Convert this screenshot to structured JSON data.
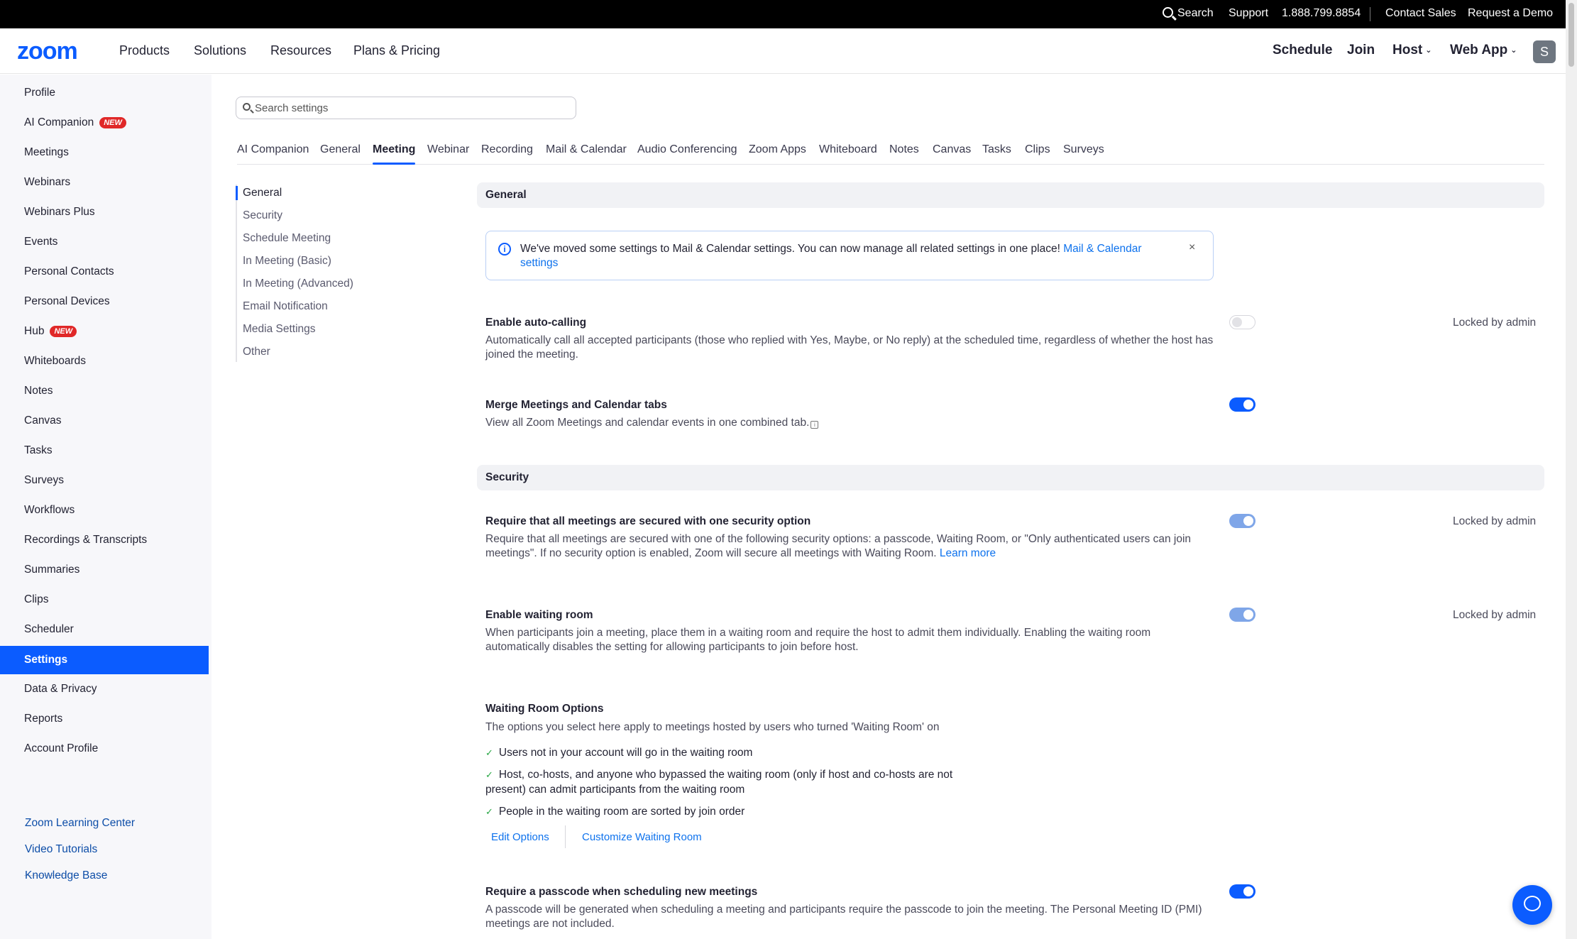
{
  "topbar": {
    "search": "Search",
    "support": "Support",
    "phone": "1.888.799.8854",
    "contact_sales": "Contact Sales",
    "request_demo": "Request a Demo"
  },
  "nav": {
    "logo": "zoom",
    "items": [
      "Products",
      "Solutions",
      "Resources",
      "Plans & Pricing"
    ],
    "schedule": "Schedule",
    "join": "Join",
    "host": "Host",
    "web_app": "Web App",
    "avatar_initial": "S"
  },
  "sidebar": {
    "items": [
      {
        "label": "Profile"
      },
      {
        "label": "AI Companion",
        "badge": "NEW"
      },
      {
        "label": "Meetings"
      },
      {
        "label": "Webinars"
      },
      {
        "label": "Webinars Plus"
      },
      {
        "label": "Events"
      },
      {
        "label": "Personal Contacts"
      },
      {
        "label": "Personal Devices"
      },
      {
        "label": "Hub",
        "badge": "NEW"
      },
      {
        "label": "Whiteboards"
      },
      {
        "label": "Notes"
      },
      {
        "label": "Canvas"
      },
      {
        "label": "Tasks"
      },
      {
        "label": "Surveys"
      },
      {
        "label": "Workflows"
      },
      {
        "label": "Recordings & Transcripts"
      },
      {
        "label": "Summaries"
      },
      {
        "label": "Clips"
      },
      {
        "label": "Scheduler"
      },
      {
        "label": "Settings"
      },
      {
        "label": "Data & Privacy"
      },
      {
        "label": "Reports"
      },
      {
        "label": "Account Profile"
      }
    ],
    "links": [
      "Zoom Learning Center",
      "Video Tutorials",
      "Knowledge Base"
    ]
  },
  "search": {
    "placeholder": "Search settings"
  },
  "tabs": [
    "AI Companion",
    "General",
    "Meeting",
    "Webinar",
    "Recording",
    "Mail & Calendar",
    "Audio Conferencing",
    "Zoom Apps",
    "Whiteboard",
    "Notes",
    "Canvas",
    "Tasks",
    "Clips",
    "Surveys"
  ],
  "subnav": [
    "General",
    "Security",
    "Schedule Meeting",
    "In Meeting (Basic)",
    "In Meeting (Advanced)",
    "Email Notification",
    "Media Settings",
    "Other"
  ],
  "sections": {
    "general": "General",
    "security": "Security"
  },
  "notice": {
    "text": "We've moved some settings to Mail & Calendar settings. You can now manage all related settings in one place! ",
    "link": "Mail & Calendar settings",
    "close": "×"
  },
  "settings": {
    "auto_calling": {
      "title": "Enable auto-calling",
      "desc": "Automatically call all accepted participants (those who replied with Yes, Maybe, or No reply) at the scheduled time, regardless of whether the host has joined the meeting.",
      "locked": "Locked by admin"
    },
    "merge_tabs": {
      "title": "Merge Meetings and Calendar tabs",
      "desc": "View all Zoom Meetings and calendar events in one combined tab."
    },
    "secure_option": {
      "title": "Require that all meetings are secured with one security option",
      "desc": "Require that all meetings are secured with one of the following security options: a passcode, Waiting Room, or \"Only authenticated users can join meetings\". If no security option is enabled, Zoom will secure all meetings with Waiting Room. ",
      "link": "Learn more",
      "locked": "Locked by admin"
    },
    "waiting_room": {
      "title": "Enable waiting room",
      "desc": "When participants join a meeting, place them in a waiting room and require the host to admit them individually. Enabling the waiting room automatically disables the setting for allowing participants to join before host.",
      "locked": "Locked by admin"
    },
    "waiting_room_options": {
      "title": "Waiting Room Options",
      "desc": "The options you select here apply to meetings hosted by users who turned 'Waiting Room' on",
      "checks": [
        "Users not in your account will go in the waiting room",
        "Host, co-hosts, and anyone who bypassed the waiting room (only if host and co-hosts are not present) can admit participants from the waiting room",
        "People in the waiting room are sorted by join order"
      ],
      "edit_options": "Edit Options",
      "customize": "Customize Waiting Room"
    },
    "passcode": {
      "title": "Require a passcode when scheduling new meetings",
      "desc": "A passcode will be generated when scheduling a meeting and participants require the passcode to join the meeting. The Personal Meeting ID (PMI) meetings are not included."
    }
  }
}
